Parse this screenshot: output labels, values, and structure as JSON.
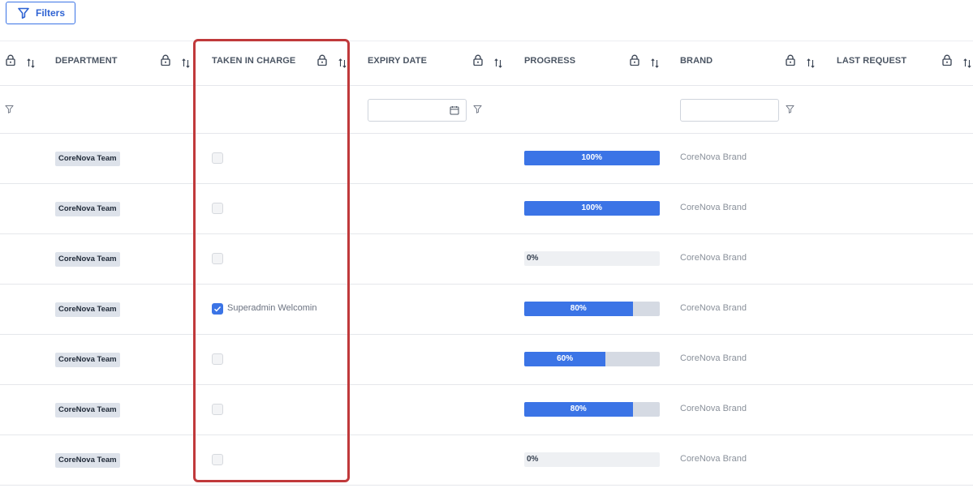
{
  "toolbar": {
    "filters_label": "Filters"
  },
  "columns": [
    {
      "key": "select",
      "label": ""
    },
    {
      "key": "department",
      "label": "DEPARTMENT"
    },
    {
      "key": "taken_in_charge",
      "label": "TAKEN IN CHARGE"
    },
    {
      "key": "expiry_date",
      "label": "EXPIRY DATE"
    },
    {
      "key": "progress",
      "label": "PROGRESS"
    },
    {
      "key": "brand",
      "label": "BRAND"
    },
    {
      "key": "last_request",
      "label": "LAST REQUEST"
    }
  ],
  "filters": {
    "expiry_date": {
      "value": "",
      "placeholder": ""
    },
    "brand": {
      "value": "",
      "placeholder": ""
    }
  },
  "rows": [
    {
      "department": "CoreNova Team",
      "taken": false,
      "taken_label": "",
      "progress": 100,
      "progress_label": "100%",
      "brand": "CoreNova Brand"
    },
    {
      "department": "CoreNova Team",
      "taken": false,
      "taken_label": "",
      "progress": 100,
      "progress_label": "100%",
      "brand": "CoreNova Brand"
    },
    {
      "department": "CoreNova Team",
      "taken": false,
      "taken_label": "",
      "progress": 0,
      "progress_label": "0%",
      "brand": "CoreNova Brand"
    },
    {
      "department": "CoreNova Team",
      "taken": true,
      "taken_label": "Superadmin Welcomin",
      "progress": 80,
      "progress_label": "80%",
      "brand": "CoreNova Brand"
    },
    {
      "department": "CoreNova Team",
      "taken": false,
      "taken_label": "",
      "progress": 60,
      "progress_label": "60%",
      "brand": "CoreNova Brand"
    },
    {
      "department": "CoreNova Team",
      "taken": false,
      "taken_label": "",
      "progress": 80,
      "progress_label": "80%",
      "brand": "CoreNova Brand"
    },
    {
      "department": "CoreNova Team",
      "taken": false,
      "taken_label": "",
      "progress": 0,
      "progress_label": "0%",
      "brand": "CoreNova Brand"
    }
  ],
  "colors": {
    "accent": "#3b74e6",
    "highlight": "#c0393b",
    "badge_bg": "#dde2ea",
    "track": "#d5dae3"
  },
  "icons": {
    "filter": "funnel-icon",
    "lock": "lock-icon",
    "sort": "sort-icon",
    "calendar": "calendar-icon",
    "check": "check-icon"
  }
}
